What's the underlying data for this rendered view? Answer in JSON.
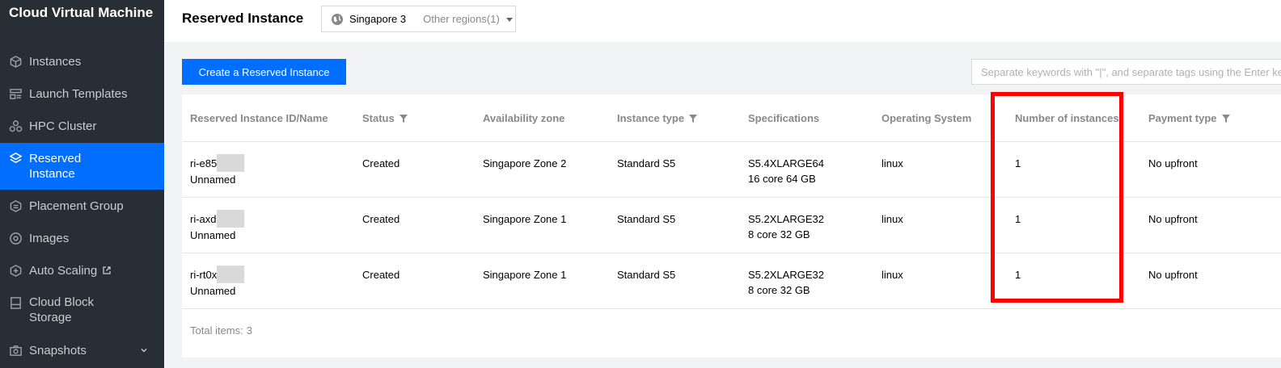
{
  "sidebar": {
    "brand": "Cloud Virtual Machine",
    "items": [
      {
        "label": "Instances",
        "icon": "cube-icon"
      },
      {
        "label": "Launch Templates",
        "icon": "template-icon"
      },
      {
        "label": "HPC Cluster",
        "icon": "cluster-icon"
      },
      {
        "label": "Reserved Instance",
        "icon": "layers-icon",
        "active": true
      },
      {
        "label": "Placement Group",
        "icon": "placement-icon"
      },
      {
        "label": "Images",
        "icon": "disc-icon"
      },
      {
        "label": "Auto Scaling",
        "icon": "scaling-icon",
        "external": true
      },
      {
        "label": "Cloud Block Storage",
        "icon": "storage-icon"
      },
      {
        "label": "Snapshots",
        "icon": "camera-icon",
        "expandable": true
      }
    ]
  },
  "header": {
    "title": "Reserved Instance",
    "region": {
      "current": "Singapore 3",
      "other": "Other regions(1)"
    }
  },
  "toolbar": {
    "create_label": "Create a Reserved Instance",
    "search_placeholder": "Separate keywords with \"|\", and separate tags using the Enter key"
  },
  "table": {
    "columns": [
      {
        "label": "Reserved Instance ID/Name",
        "filter": false
      },
      {
        "label": "Status",
        "filter": true
      },
      {
        "label": "Availability zone",
        "filter": false
      },
      {
        "label": "Instance type",
        "filter": true
      },
      {
        "label": "Specifications",
        "filter": false
      },
      {
        "label": "Operating System",
        "filter": false
      },
      {
        "label": "Number of instances",
        "filter": false
      },
      {
        "label": "Payment type",
        "filter": true
      }
    ],
    "rows": [
      {
        "id": "ri-e85",
        "name": "Unnamed",
        "status": "Created",
        "zone": "Singapore Zone 2",
        "type": "Standard S5",
        "spec": "S5.4XLARGE64",
        "spec_detail": "16 core 64 GB",
        "os": "linux",
        "count": "1",
        "payment": "No upfront"
      },
      {
        "id": "ri-axd",
        "name": "Unnamed",
        "status": "Created",
        "zone": "Singapore Zone 1",
        "type": "Standard S5",
        "spec": "S5.2XLARGE32",
        "spec_detail": "8 core 32 GB",
        "os": "linux",
        "count": "1",
        "payment": "No upfront"
      },
      {
        "id": "ri-rt0x",
        "name": "Unnamed",
        "status": "Created",
        "zone": "Singapore Zone 1",
        "type": "Standard S5",
        "spec": "S5.2XLARGE32",
        "spec_detail": "8 core 32 GB",
        "os": "linux",
        "count": "1",
        "payment": "No upfront"
      }
    ],
    "total_label": "Total items:",
    "total_value": "3"
  },
  "colors": {
    "accent": "#006eff",
    "sidebar_bg": "#282d36",
    "highlight": "#ff0000"
  }
}
